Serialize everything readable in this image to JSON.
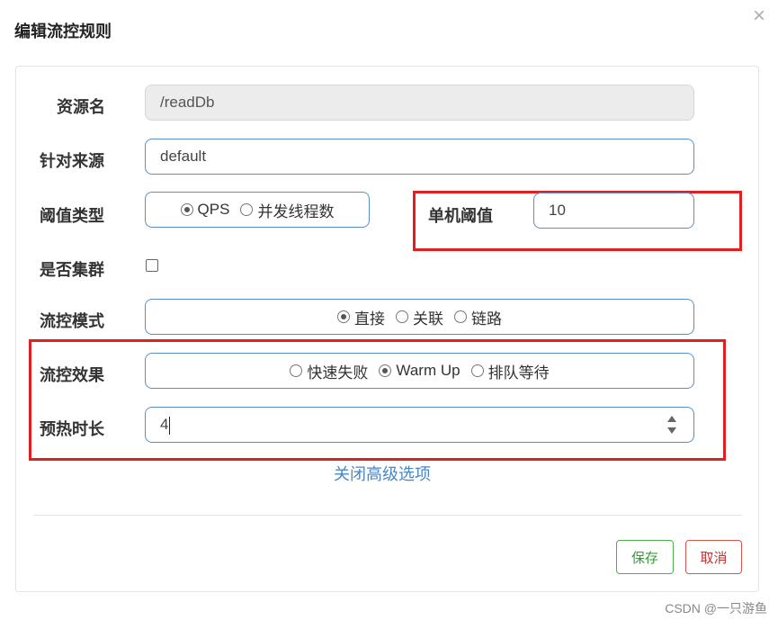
{
  "dialog": {
    "title": "编辑流控规则",
    "close_icon": "×"
  },
  "form": {
    "resource_name": {
      "label": "资源名",
      "value": "/readDb"
    },
    "limit_app": {
      "label": "针对来源",
      "value": "default"
    },
    "threshold_type": {
      "label": "阈值类型",
      "options": [
        "QPS",
        "并发线程数"
      ],
      "selected": "QPS"
    },
    "single_threshold": {
      "label": "单机阈值",
      "value": "10"
    },
    "cluster_mode": {
      "label": "是否集群",
      "checked": false
    },
    "control_mode": {
      "label": "流控模式",
      "options": [
        "直接",
        "关联",
        "链路"
      ],
      "selected": "直接"
    },
    "control_effect": {
      "label": "流控效果",
      "options": [
        "快速失败",
        "Warm Up",
        "排队等待"
      ],
      "selected": "Warm Up"
    },
    "warmup_period": {
      "label": "预热时长",
      "value": "4"
    },
    "advanced_toggle": "关闭高级选项"
  },
  "footer": {
    "save_label": "保存",
    "cancel_label": "取消"
  },
  "watermark": "CSDN @一只游鱼",
  "colors": {
    "highlight_border": "#e02020",
    "input_border": "#5a8fc4",
    "link": "#4a86c5",
    "save": "#3a9a3a",
    "cancel": "#c9302c"
  }
}
